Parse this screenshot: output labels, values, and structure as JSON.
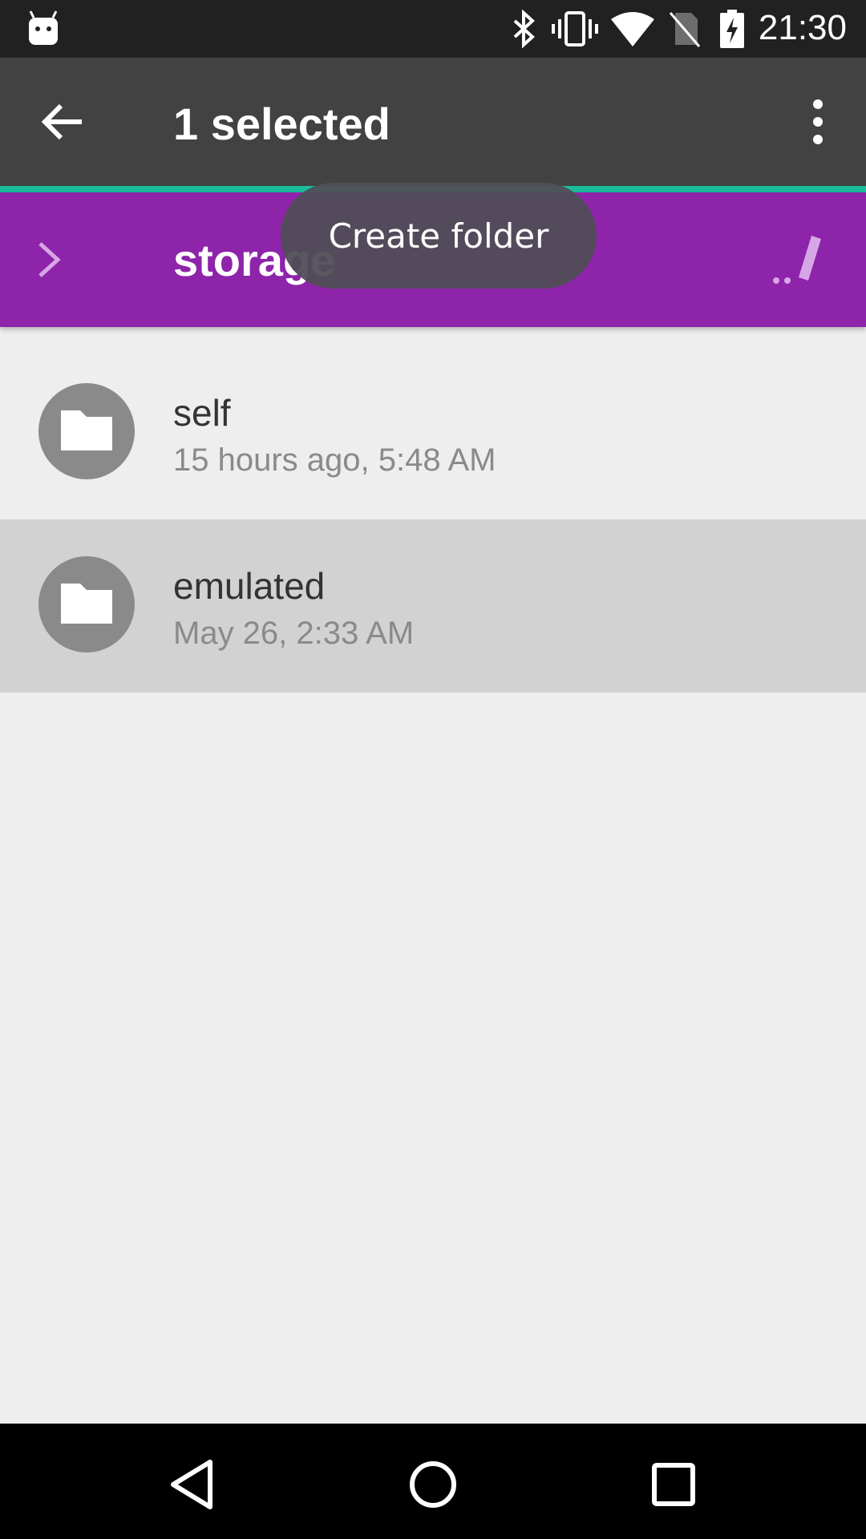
{
  "status_bar": {
    "time": "21:30",
    "icons": [
      "android-notification-icon",
      "bluetooth-icon",
      "vibrate-icon",
      "wifi-icon",
      "no-sim-icon",
      "battery-charging-icon"
    ]
  },
  "app_bar": {
    "title": "1 selected",
    "back_icon": "arrow-back-icon",
    "menu_icon": "more-vert-icon"
  },
  "path_bar": {
    "current": "storage",
    "chevron_icon": "chevron-right-icon",
    "edit_icon": "edit-path-icon",
    "accent_color": "#8e24aa"
  },
  "toast": {
    "text": "Create folder"
  },
  "files": [
    {
      "name": "self",
      "meta": "15 hours ago, 5:48 AM",
      "icon": "folder-icon",
      "selected": false
    },
    {
      "name": "emulated",
      "meta": "May 26, 2:33 AM",
      "icon": "folder-icon",
      "selected": true
    }
  ],
  "nav_bar": {
    "buttons": [
      "back-nav-icon",
      "home-nav-icon",
      "recents-nav-icon"
    ]
  }
}
